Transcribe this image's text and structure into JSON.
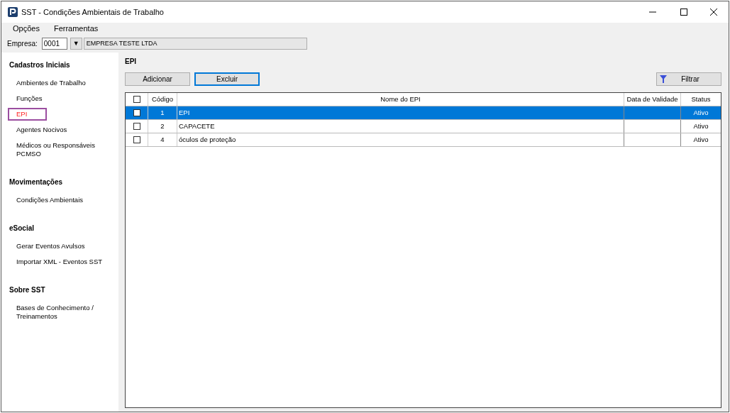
{
  "window": {
    "title": "SST - Condições Ambientais de Trabalho"
  },
  "menu": [
    "Opções",
    "Ferramentas"
  ],
  "company": {
    "label": "Empresa:",
    "code": "0001",
    "dropdown": "▼",
    "name": "EMPRESA TESTE LTDA"
  },
  "sidebar": [
    {
      "title": "Cadastros Iniciais",
      "items": [
        {
          "label": "Ambientes de Trabalho",
          "selected": false
        },
        {
          "label": "Funções",
          "selected": false
        },
        {
          "label": "EPI",
          "selected": true
        },
        {
          "label": "Agentes Nocivos",
          "selected": false
        },
        {
          "label": "Médicos ou Responsáveis PCMSO",
          "selected": false
        }
      ]
    },
    {
      "title": "Movimentações",
      "items": [
        {
          "label": "Condições Ambientais",
          "selected": false
        }
      ]
    },
    {
      "title": "eSocial",
      "items": [
        {
          "label": "Gerar Eventos Avulsos",
          "selected": false
        },
        {
          "label": "Importar XML - Eventos SST",
          "selected": false
        }
      ]
    },
    {
      "title": "Sobre SST",
      "items": [
        {
          "label": "Bases de Conhecimento / Treinamentos",
          "selected": false
        }
      ]
    }
  ],
  "page_title": "EPI",
  "buttons": [
    "Adicionar",
    "Excluir"
  ],
  "filter_button": "Filtrar",
  "table": {
    "columns": [
      "Código",
      "Nome do EPI",
      "Data de Validade",
      "Status"
    ],
    "header_checked": false,
    "rows": [
      {
        "checked": false,
        "selected": true,
        "code": "1",
        "name": "EPI",
        "status": "Ativo"
      },
      {
        "checked": false,
        "selected": false,
        "code": "2",
        "name": "CAPACETE",
        "status": "Ativo"
      },
      {
        "checked": false,
        "selected": false,
        "code": "4",
        "name": "óculos de proteção",
        "status": "Ativo"
      }
    ]
  }
}
